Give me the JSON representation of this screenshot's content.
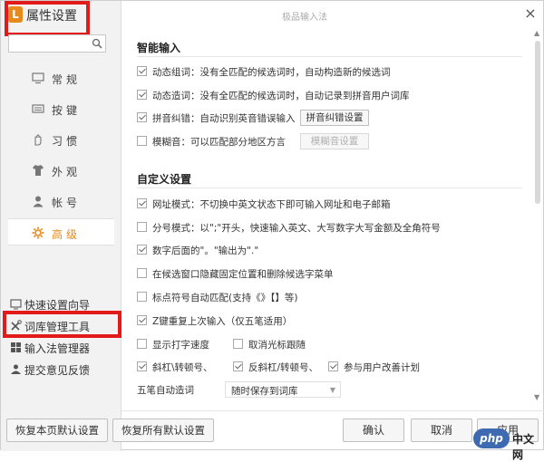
{
  "app": {
    "logo": "L",
    "title": "属性设置",
    "titlebar": "极品输入法",
    "close": "×"
  },
  "colors": {
    "accent": "#e8891c",
    "highlight": "#e21a1a"
  },
  "nav": [
    {
      "label": "常规",
      "icon": "monitor-icon"
    },
    {
      "label": "按键",
      "icon": "keyboard-icon"
    },
    {
      "label": "习惯",
      "icon": "hand-icon"
    },
    {
      "label": "外观",
      "icon": "shirt-icon"
    },
    {
      "label": "帐号",
      "icon": "user-icon"
    },
    {
      "label": "高级",
      "icon": "gear-icon",
      "active": true
    }
  ],
  "tools": [
    {
      "label": "快速设置向导",
      "icon": "wizard-icon"
    },
    {
      "label": "词库管理工具",
      "icon": "tools-icon"
    },
    {
      "label": "输入法管理器",
      "icon": "grid-icon"
    },
    {
      "label": "提交意见反馈",
      "icon": "feedback-icon"
    }
  ],
  "sections": {
    "smart": "智能输入",
    "custom": "自定义设置"
  },
  "options": {
    "o1": "动态组词：没有全匹配的候选词时，自动构造新的候选词",
    "o2": "动态造词：没有全匹配的候选词时，自动记录到拼音用户词库",
    "o3": "拼音纠错：自动识别英音错误输入",
    "o4": "模糊音：可以匹配部分地区方言",
    "o5": "网址模式：不切换中英文状态下即可输入网址和电子邮箱",
    "o6": "分号模式：以\";\"开头，快速输入英文、大写数字大写金额及全角符号",
    "o7": "数字后面的\"。\"输出为\".\"",
    "o8": "在候选窗口隐藏固定位置和删除候选字菜单",
    "o9": "标点符号自动匹配(支持《》【】等)",
    "o10": "Z键重复上次输入（仅五笔适用）",
    "o11": "显示打字速度",
    "o12": "取消光标跟随",
    "o13": "斜杠\\转顿号、",
    "o14": "反斜杠/转顿号、",
    "o15": "参与用户改善计划"
  },
  "buttons": {
    "pinyin_fix": "拼音纠错设置",
    "fuzzy": "模糊音设置",
    "restore_page": "恢复本页默认设置",
    "restore_all": "恢复所有默认设置",
    "ok": "确认",
    "cancel": "取消",
    "apply": "应用"
  },
  "wubi": {
    "label": "五笔自动造词",
    "value": "随时保存到词库"
  },
  "watermark": {
    "logo": "php",
    "text": "中文网"
  }
}
